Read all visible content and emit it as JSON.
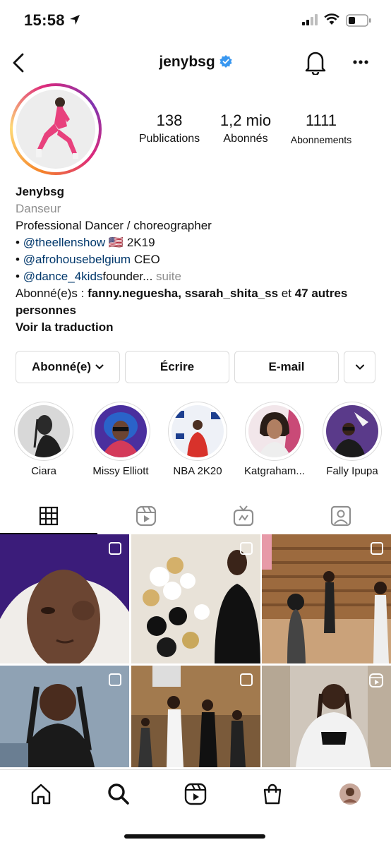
{
  "status_bar": {
    "time": "15:58"
  },
  "header": {
    "username": "jenybsg",
    "verified": true
  },
  "profile": {
    "stats": [
      {
        "value": "138",
        "label": "Publications"
      },
      {
        "value": "1,2 mio",
        "label": "Abonnés"
      },
      {
        "value": "1111",
        "label": "Abonnements"
      }
    ],
    "bio": {
      "name": "Jenybsg",
      "category": "Danseur",
      "line1": "Professional Dancer / choreographer",
      "bullet": "•",
      "line2_link": "@theellenshow",
      "line2_flag": "🇺🇸",
      "line2_text": "2K19",
      "line3_link": "@afrohousebelgium",
      "line3_text": "CEO",
      "line4_link": "@dance_4kids",
      "line4_text": "founder...",
      "line4_more": "suite",
      "followed_prefix": "Abonné(e)s :",
      "followed_user1": "fanny.neguesha",
      "followed_user2": "ssarah_shita_ss",
      "followed_and": "et",
      "followed_others": "47 autres personnes",
      "translate": "Voir la traduction"
    }
  },
  "actions": {
    "follow": "Abonné(e)",
    "message": "Écrire",
    "email": "E-mail"
  },
  "highlights": [
    {
      "label": "Ciara"
    },
    {
      "label": "Missy Elliott"
    },
    {
      "label": "NBA 2K20"
    },
    {
      "label": "Katgraham..."
    },
    {
      "label": "Fally Ipupa"
    }
  ],
  "tabs": [
    "grid-icon",
    "reels-icon",
    "igtv-icon",
    "tagged-icon"
  ],
  "colors": {
    "link": "#00376b",
    "muted": "#8e8e8e",
    "verified": "#3897f0",
    "border": "#dbdbdb"
  }
}
